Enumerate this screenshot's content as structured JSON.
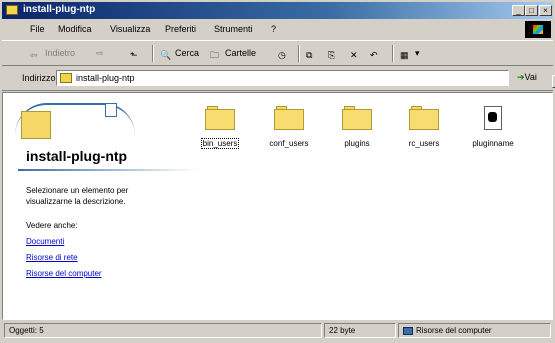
{
  "window": {
    "title": "install-plug-ntp",
    "buttons": {
      "minimize": "_",
      "maximize": "□",
      "close": "×"
    }
  },
  "menu": [
    "File",
    "Modifica",
    "Visualizza",
    "Preferiti",
    "Strumenti",
    "?"
  ],
  "toolbar": {
    "back": "Indietro",
    "search": "Cerca",
    "folders": "Cartelle"
  },
  "address": {
    "label": "Indirizzo",
    "value": "install-plug-ntp",
    "go": "Vai"
  },
  "panel": {
    "folder_title": "install-plug-ntp",
    "description": "Selezionare un elemento per visualizzarne la descrizione.",
    "see_also": "Vedere anche:",
    "links": [
      "Documenti",
      "Risorse di rete",
      "Risorse del computer"
    ]
  },
  "items": [
    {
      "name": "bin_users",
      "kind": "folder",
      "selected": true
    },
    {
      "name": "conf_users",
      "kind": "folder",
      "selected": false
    },
    {
      "name": "plugins",
      "kind": "folder",
      "selected": false
    },
    {
      "name": "rc_users",
      "kind": "folder",
      "selected": false
    },
    {
      "name": "pluginname",
      "kind": "file",
      "selected": false
    }
  ],
  "status": {
    "objects": "Oggetti: 5",
    "size": "22 byte",
    "location": "Risorse del computer"
  }
}
